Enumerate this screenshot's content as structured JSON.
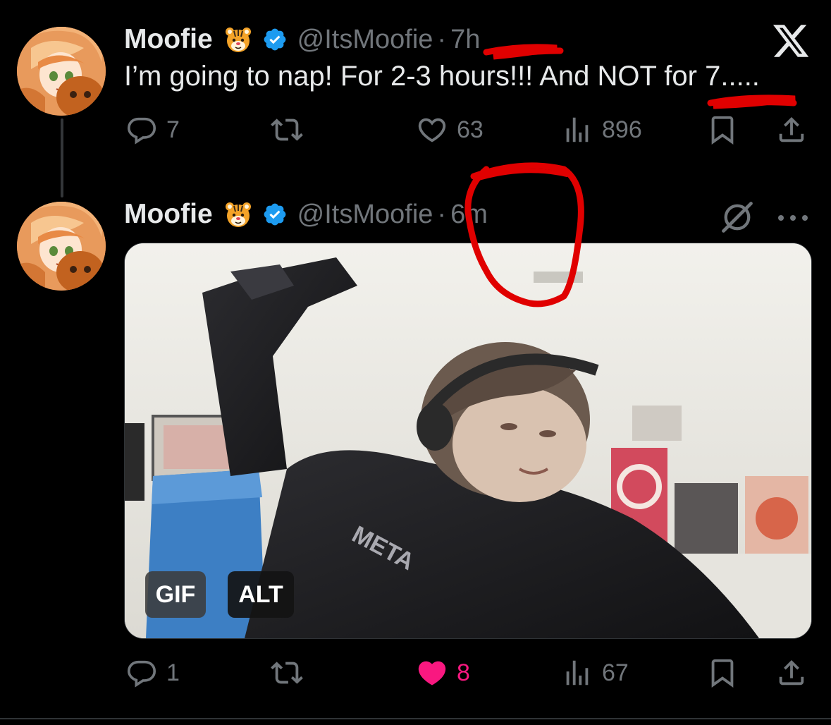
{
  "tweets": [
    {
      "name": "Moofie",
      "handle": "@ItsMoofie",
      "separator": "·",
      "time": "7h",
      "text": "I’m going to nap! For 2-3 hours!!! And NOT for 7.....",
      "actions": {
        "replies": "7",
        "retweets": "",
        "likes": "63",
        "views": "896"
      }
    },
    {
      "name": "Moofie",
      "handle": "@ItsMoofie",
      "separator": "·",
      "time": "6m",
      "media": {
        "gif_label": "GIF",
        "alt_label": "ALT"
      },
      "actions": {
        "replies": "1",
        "retweets": "",
        "likes": "8",
        "views": "67",
        "liked": true
      }
    }
  ],
  "icons": {
    "brand": "x-logo-icon",
    "verified": "verified-badge-icon",
    "emoji": "tiger-face-emoji",
    "reply": "reply-icon",
    "retweet": "retweet-icon",
    "like": "heart-icon",
    "views": "views-icon",
    "bookmark": "bookmark-icon",
    "share": "share-icon",
    "grok": "grok-icon",
    "more": "more-icon"
  },
  "colors": {
    "background": "#000000",
    "text_primary": "#e7e9ea",
    "text_secondary": "#71767b",
    "verified_blue": "#1d9bf0",
    "like_pink": "#f91880",
    "annotation_red": "#e00000"
  }
}
